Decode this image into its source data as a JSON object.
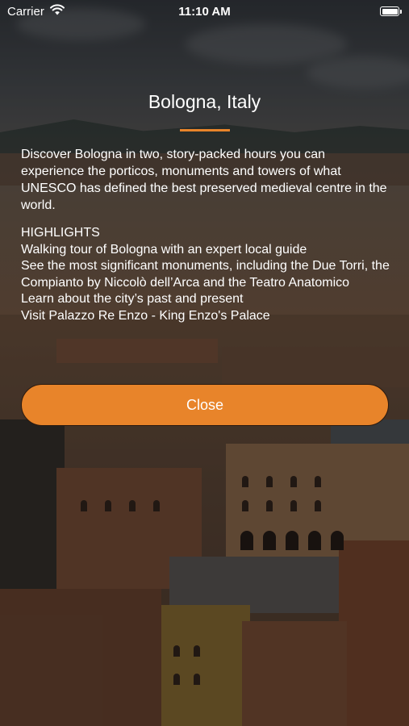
{
  "status_bar": {
    "carrier": "Carrier",
    "time": "11:10 AM"
  },
  "content": {
    "title": "Bologna, Italy",
    "description": "Discover Bologna in two, story-packed hours you can experience the porticos, monuments and towers of what UNESCO has defined the best preserved medieval centre in the world.",
    "highlights_heading": "HIGHLIGHTS",
    "highlights": [
      "Walking tour of Bologna with an expert local guide",
      "See the most significant monuments, including the Due Torri, the Compianto by Niccolò dell’Arca and the Teatro Anatomico",
      "Learn about the city’s past and present",
      "Visit Palazzo Re Enzo - King Enzo's Palace"
    ]
  },
  "close_button": {
    "label": "Close"
  },
  "colors": {
    "accent": "#e8842a",
    "text": "#ffffff"
  },
  "icons": {
    "wifi": "wifi-icon",
    "battery": "battery-icon"
  }
}
